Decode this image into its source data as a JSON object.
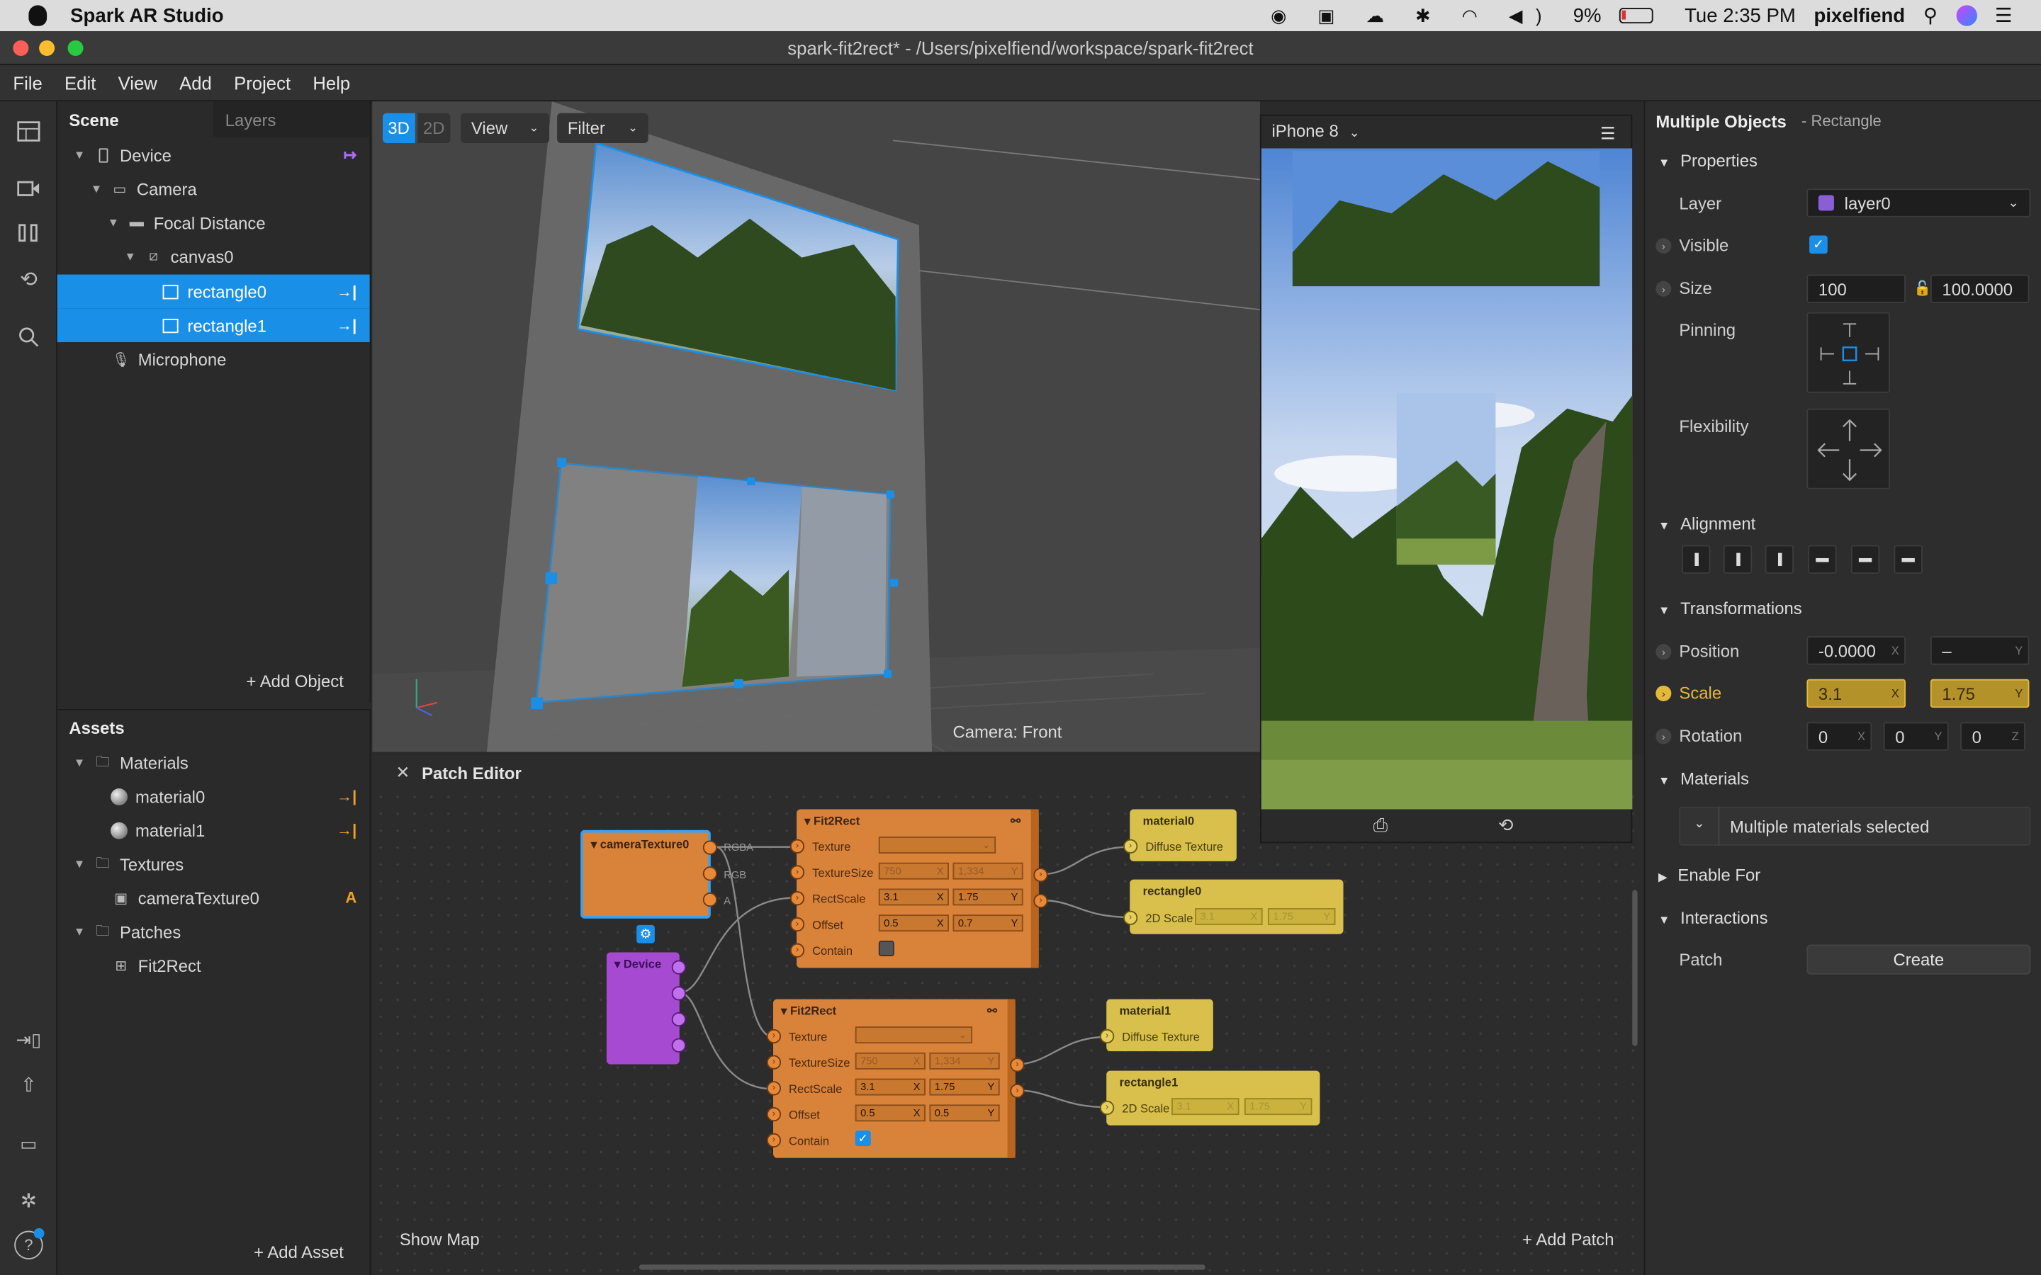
{
  "macbar": {
    "app": "Spark AR Studio",
    "battery": "9%",
    "clock": "Tue 2:35 PM",
    "user": "pixelfiend"
  },
  "window": {
    "title": "spark-fit2rect* - /Users/pixelfiend/workspace/spark-fit2rect"
  },
  "menu": [
    "File",
    "Edit",
    "View",
    "Add",
    "Project",
    "Help"
  ],
  "scene": {
    "tabs": [
      "Scene",
      "Layers"
    ],
    "items": [
      {
        "label": "Device",
        "icon": "phone-icon"
      },
      {
        "label": "Camera",
        "icon": "camera-icon"
      },
      {
        "label": "Focal Distance",
        "icon": "focal-icon"
      },
      {
        "label": "canvas0",
        "icon": "canvas-icon"
      },
      {
        "label": "rectangle0",
        "icon": "rectangle-icon"
      },
      {
        "label": "rectangle1",
        "icon": "rectangle-icon"
      },
      {
        "label": "Microphone",
        "icon": "microphone-icon"
      }
    ],
    "add_object": "Add Object"
  },
  "assets": {
    "title": "Assets",
    "items": [
      {
        "label": "Materials",
        "icon": "folder-icon"
      },
      {
        "label": "material0",
        "icon": "sphere-icon"
      },
      {
        "label": "material1",
        "icon": "sphere-icon"
      },
      {
        "label": "Textures",
        "icon": "folder-icon"
      },
      {
        "label": "cameraTexture0",
        "icon": "image-icon",
        "badge": "A"
      },
      {
        "label": "Patches",
        "icon": "folder-icon"
      },
      {
        "label": "Fit2Rect",
        "icon": "patch-icon"
      }
    ],
    "add_asset": "Add Asset"
  },
  "viewport": {
    "mode3d": "3D",
    "mode2d": "2D",
    "view": "View",
    "filter": "Filter",
    "camera_label": "Camera: Front"
  },
  "preview": {
    "device": "iPhone 8"
  },
  "patch_editor": {
    "title": "Patch Editor",
    "show_map": "Show Map",
    "add_patch": "Add Patch",
    "camera_texture": {
      "title": "cameraTexture0",
      "outputs": [
        "RGBA",
        "RGB",
        "A"
      ]
    },
    "device": {
      "title": "Device"
    },
    "fit1": {
      "title": "Fit2Rect",
      "ports": [
        "Texture",
        "TextureSize",
        "RectScale",
        "Offset",
        "Contain"
      ],
      "tex_w": "750",
      "tex_h": "1,334",
      "scale_x": "3.1",
      "scale_y": "1.75",
      "off_x": "0.5",
      "off_y": "0.7"
    },
    "fit2": {
      "title": "Fit2Rect",
      "ports": [
        "Texture",
        "TextureSize",
        "RectScale",
        "Offset",
        "Contain"
      ],
      "tex_w": "750",
      "tex_h": "1,334",
      "scale_x": "3.1",
      "scale_y": "1.75",
      "off_x": "0.5",
      "off_y": "0.5"
    },
    "mat0": {
      "title": "material0",
      "port": "Diffuse Texture"
    },
    "rect0": {
      "title": "rectangle0",
      "port": "2D Scale",
      "x": "3.1",
      "y": "1.75"
    },
    "mat1": {
      "title": "material1",
      "port": "Diffuse Texture"
    },
    "rect1": {
      "title": "rectangle1",
      "port": "2D Scale",
      "x": "3.1",
      "y": "1.75"
    }
  },
  "inspector": {
    "title": "Multiple Objects",
    "subtitle": "- Rectangle",
    "properties": "Properties",
    "layer_label": "Layer",
    "layer_value": "layer0",
    "visible_label": "Visible",
    "size_label": "Size",
    "size_w": "100",
    "size_h": "100.0000",
    "pinning_label": "Pinning",
    "flexibility_label": "Flexibility",
    "alignment": "Alignment",
    "transformations": "Transformations",
    "position_label": "Position",
    "pos_x": "-0.0000",
    "pos_y": "–",
    "scale_label": "Scale",
    "scale_x": "3.1",
    "scale_y": "1.75",
    "rotation_label": "Rotation",
    "rot_x": "0",
    "rot_y": "0",
    "rot_z": "0",
    "materials": "Materials",
    "materials_value": "Multiple materials selected",
    "enable_for": "Enable For",
    "interactions": "Interactions",
    "patch_label": "Patch",
    "create": "Create",
    "axes": {
      "x": "X",
      "y": "Y",
      "z": "Z"
    }
  },
  "colors": {
    "accent": "#1a8fe8",
    "patch_orange": "#d9823a",
    "patch_yellow": "#d9c04c",
    "patch_purple": "#a64bd1",
    "layer_swatch": "#8a5fd6"
  }
}
